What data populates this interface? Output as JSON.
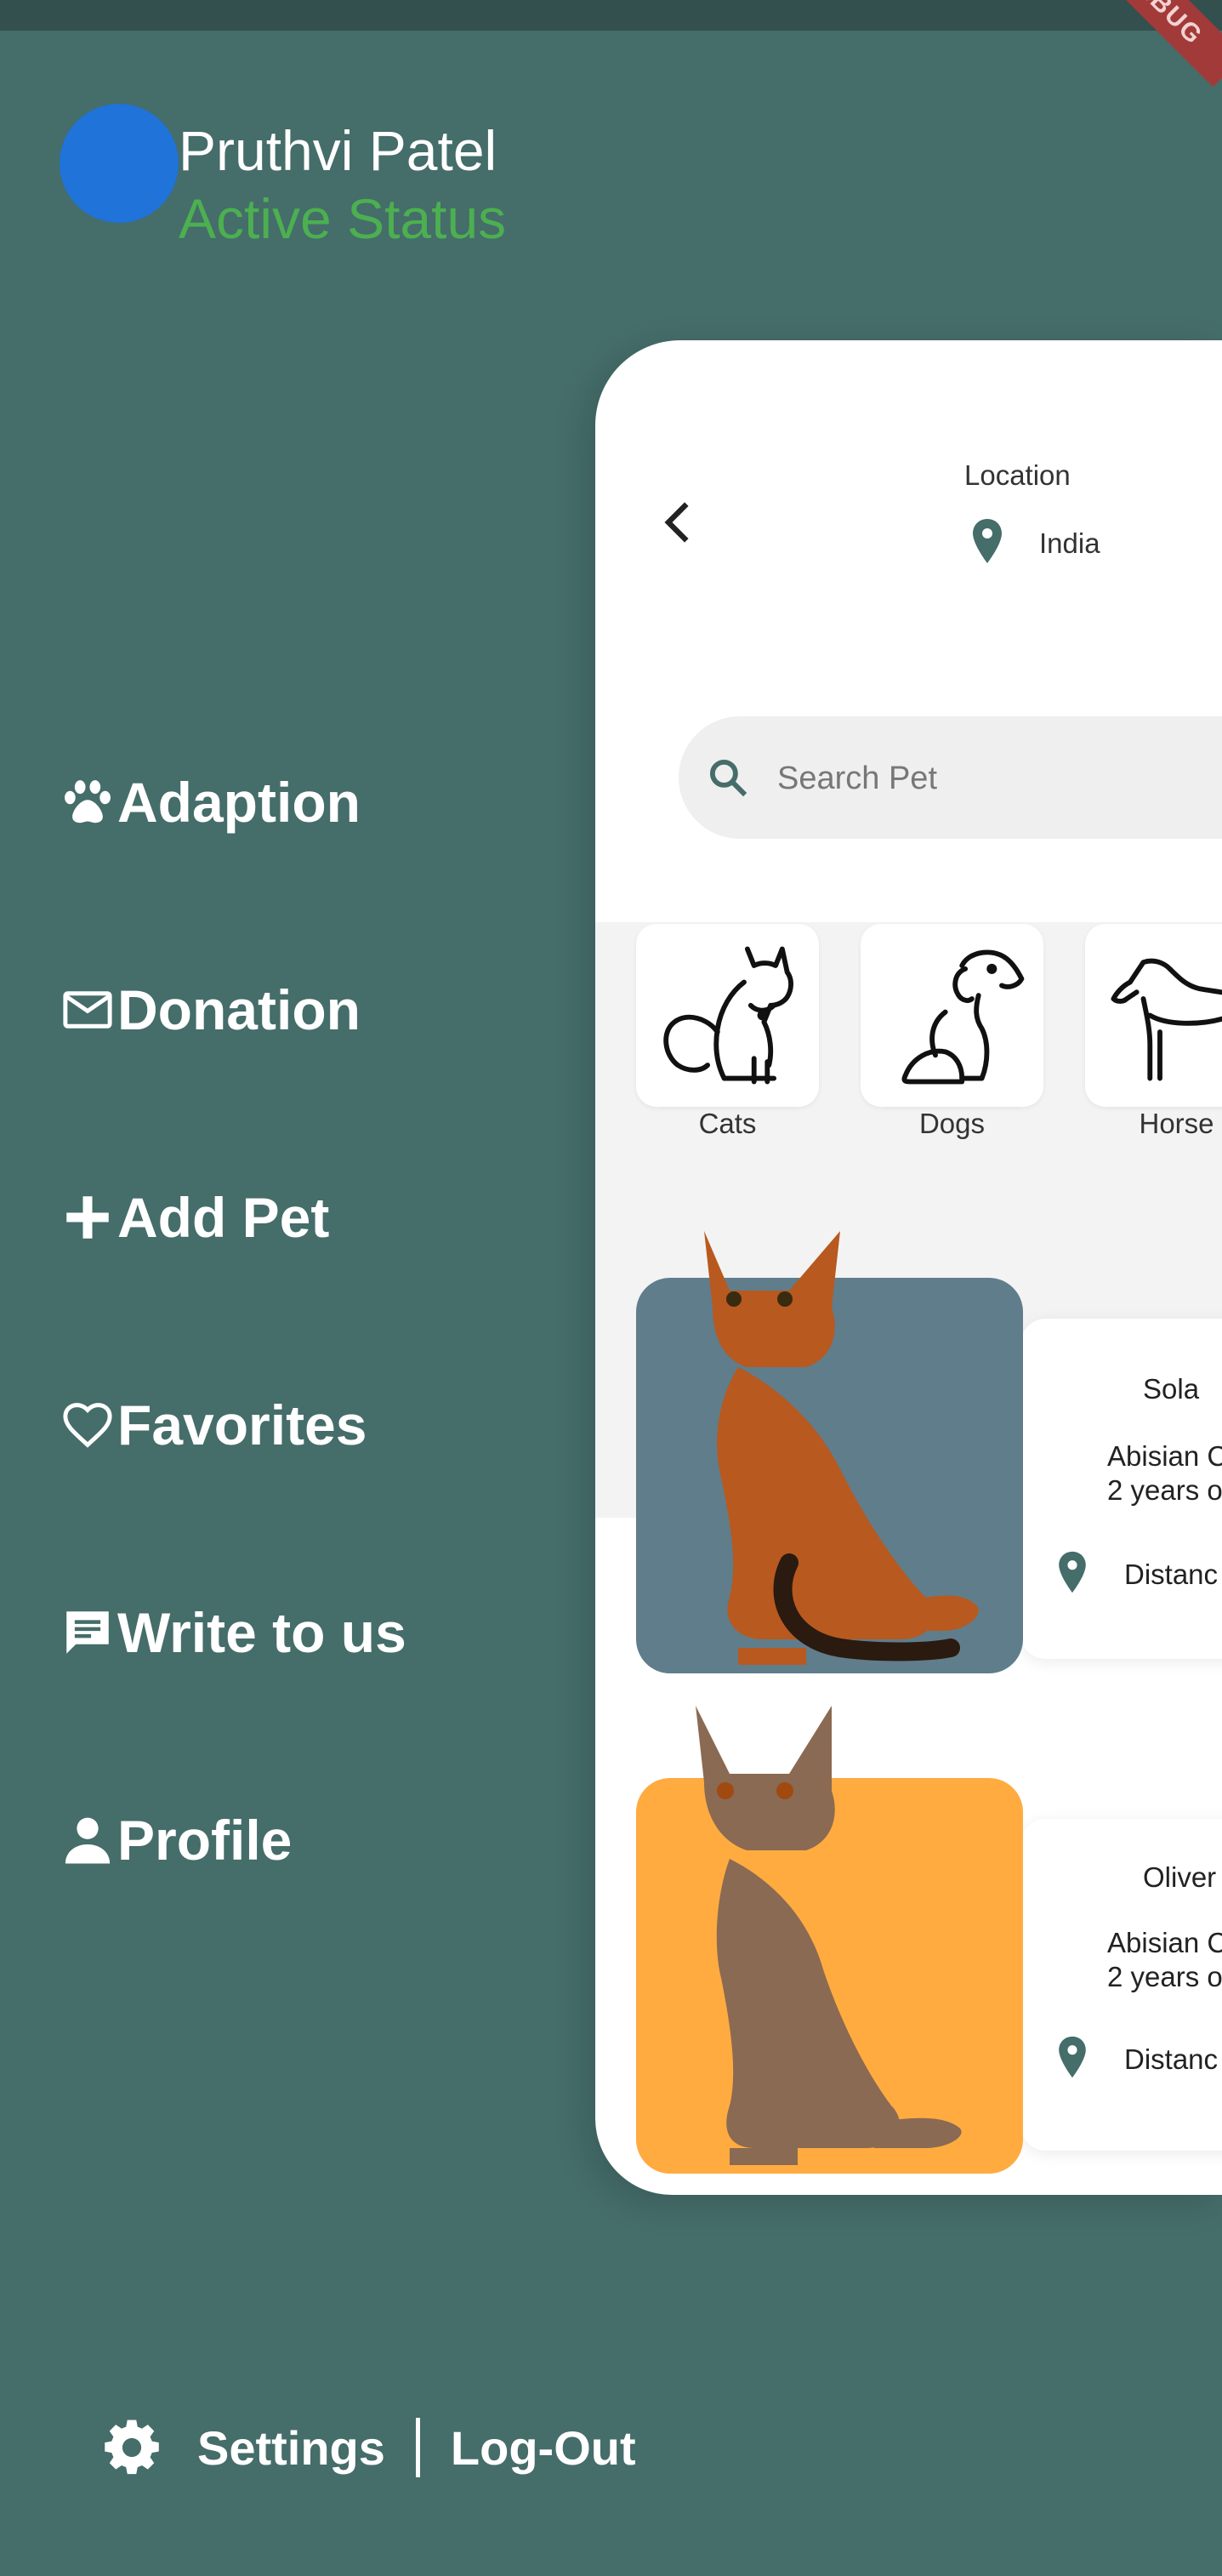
{
  "drawer": {
    "user_name": "Pruthvi Patel",
    "status": "Active Status",
    "menu": [
      {
        "label": "Adaption",
        "icon": "paw-icon"
      },
      {
        "label": "Donation",
        "icon": "mail-icon"
      },
      {
        "label": "Add Pet",
        "icon": "plus-icon"
      },
      {
        "label": "Favorites",
        "icon": "heart-icon"
      },
      {
        "label": "Write to us",
        "icon": "message-icon"
      },
      {
        "label": "Profile",
        "icon": "person-icon"
      }
    ],
    "footer": {
      "settings": "Settings",
      "logout": "Log-Out"
    }
  },
  "screen": {
    "location_label": "Location",
    "location_value": "India",
    "search_placeholder": "Search Pet",
    "categories": [
      "Cats",
      "Dogs",
      "Horse"
    ],
    "pets": [
      {
        "name": "Sola",
        "breed": "Abisian C",
        "age": "2 years o",
        "distance": "Distanc",
        "bg": "#607d8b"
      },
      {
        "name": "Oliver",
        "breed": "Abisian C",
        "age": "2 years o",
        "distance": "Distanc",
        "bg": "#ffab40"
      }
    ]
  },
  "colors": {
    "drawer_bg": "#456d6a",
    "accent": "#4caf50",
    "avatar": "#1f73d9",
    "pin": "#456d6a"
  },
  "debug_banner": "DEBUG"
}
